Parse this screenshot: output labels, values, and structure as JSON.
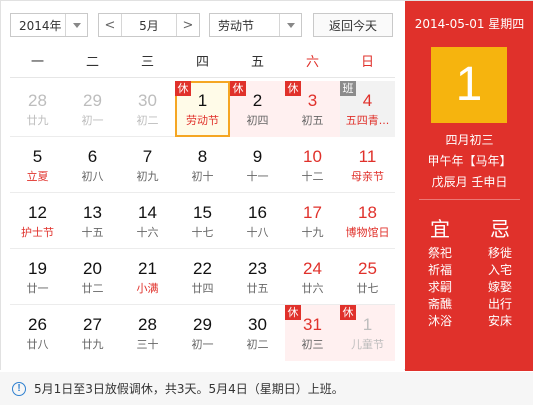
{
  "toolbar": {
    "year": "2014年",
    "prev": "<",
    "month": "5月",
    "next": ">",
    "holiday": "劳动节",
    "today_button": "返回今天"
  },
  "weekdays": [
    "一",
    "二",
    "三",
    "四",
    "五",
    "六",
    "日"
  ],
  "weeks": [
    [
      {
        "day": "28",
        "lunar": "廿九",
        "type": "other"
      },
      {
        "day": "29",
        "lunar": "初一",
        "type": "other"
      },
      {
        "day": "30",
        "lunar": "初二",
        "type": "other"
      },
      {
        "day": "1",
        "lunar": "劳动节",
        "type": "sel fest",
        "badge": "休"
      },
      {
        "day": "2",
        "lunar": "初四",
        "type": "holi",
        "badge": "休"
      },
      {
        "day": "3",
        "lunar": "初五",
        "type": "holi wkend",
        "badge": "休"
      },
      {
        "day": "4",
        "lunar": "五四青...",
        "type": "work wkend fest",
        "badge": "班"
      }
    ],
    [
      {
        "day": "5",
        "lunar": "立夏",
        "type": "term"
      },
      {
        "day": "6",
        "lunar": "初八",
        "type": ""
      },
      {
        "day": "7",
        "lunar": "初九",
        "type": ""
      },
      {
        "day": "8",
        "lunar": "初十",
        "type": ""
      },
      {
        "day": "9",
        "lunar": "十一",
        "type": ""
      },
      {
        "day": "10",
        "lunar": "十二",
        "type": "wkend"
      },
      {
        "day": "11",
        "lunar": "母亲节",
        "type": "wkend fest"
      }
    ],
    [
      {
        "day": "12",
        "lunar": "护士节",
        "type": "fest"
      },
      {
        "day": "13",
        "lunar": "十五",
        "type": ""
      },
      {
        "day": "14",
        "lunar": "十六",
        "type": ""
      },
      {
        "day": "15",
        "lunar": "十七",
        "type": ""
      },
      {
        "day": "16",
        "lunar": "十八",
        "type": ""
      },
      {
        "day": "17",
        "lunar": "十九",
        "type": "wkend"
      },
      {
        "day": "18",
        "lunar": "博物馆日",
        "type": "wkend fest"
      }
    ],
    [
      {
        "day": "19",
        "lunar": "廿一",
        "type": ""
      },
      {
        "day": "20",
        "lunar": "廿二",
        "type": ""
      },
      {
        "day": "21",
        "lunar": "小满",
        "type": "term"
      },
      {
        "day": "22",
        "lunar": "廿四",
        "type": ""
      },
      {
        "day": "23",
        "lunar": "廿五",
        "type": ""
      },
      {
        "day": "24",
        "lunar": "廿六",
        "type": "wkend"
      },
      {
        "day": "25",
        "lunar": "廿七",
        "type": "wkend"
      }
    ],
    [
      {
        "day": "26",
        "lunar": "廿八",
        "type": ""
      },
      {
        "day": "27",
        "lunar": "廿九",
        "type": ""
      },
      {
        "day": "28",
        "lunar": "三十",
        "type": ""
      },
      {
        "day": "29",
        "lunar": "初一",
        "type": ""
      },
      {
        "day": "30",
        "lunar": "初二",
        "type": ""
      },
      {
        "day": "31",
        "lunar": "初三",
        "type": "holi wkend",
        "badge": "休"
      },
      {
        "day": "1",
        "lunar": "儿童节",
        "type": "other holi",
        "badge": "休"
      }
    ]
  ],
  "panel": {
    "date": "2014-05-01 星期四",
    "day": "1",
    "lunar_date": "四月初三",
    "ganzhi_year": "甲午年【马年】",
    "ganzhi_month_day": "戊辰月 壬申日",
    "yi_label": "宜",
    "ji_label": "忌",
    "yi": [
      "祭祀",
      "祈福",
      "求嗣",
      "斋醮",
      "沐浴"
    ],
    "ji": [
      "移徙",
      "入宅",
      "嫁娶",
      "出行",
      "安床"
    ]
  },
  "footer": {
    "icon": "!",
    "text": "5月1日至3日放假调休，共3天。5月4日（星期日）上班。"
  },
  "colors": {
    "accent": "#e0312b",
    "highlight": "#f6b40e"
  }
}
